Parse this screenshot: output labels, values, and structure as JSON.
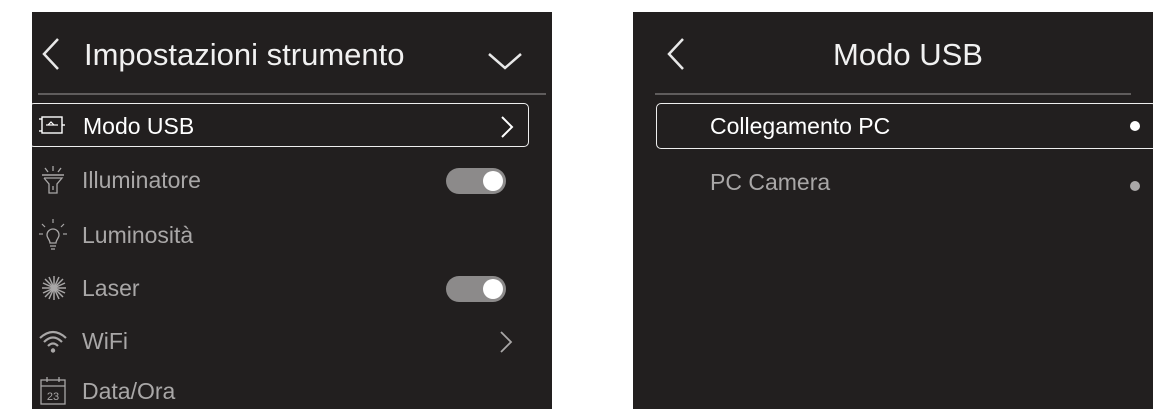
{
  "left_panel": {
    "title": "Impostazioni strumento",
    "items": [
      {
        "label": "Modo USB",
        "icon": "usb-icon",
        "control": "chevron",
        "selected": true
      },
      {
        "label": "Illuminatore",
        "icon": "flashlight-icon",
        "control": "toggle",
        "state": "on"
      },
      {
        "label": "Luminosità",
        "icon": "lightbulb-icon",
        "control": "none"
      },
      {
        "label": "Laser",
        "icon": "laser-icon",
        "control": "toggle",
        "state": "on"
      },
      {
        "label": "WiFi",
        "icon": "wifi-icon",
        "control": "chevron"
      },
      {
        "label": "Data/Ora",
        "icon": "calendar-icon",
        "control": "none"
      }
    ]
  },
  "right_panel": {
    "title": "Modo USB",
    "options": [
      {
        "label": "Collegamento PC",
        "selected": true
      },
      {
        "label": "PC Camera",
        "selected": false
      }
    ]
  },
  "calendar_day": "23",
  "colors": {
    "screen_bg": "#221f1f",
    "text_active": "#ffffff",
    "text_inactive": "#a9a7a7",
    "toggle_track": "#8c8a8a"
  }
}
